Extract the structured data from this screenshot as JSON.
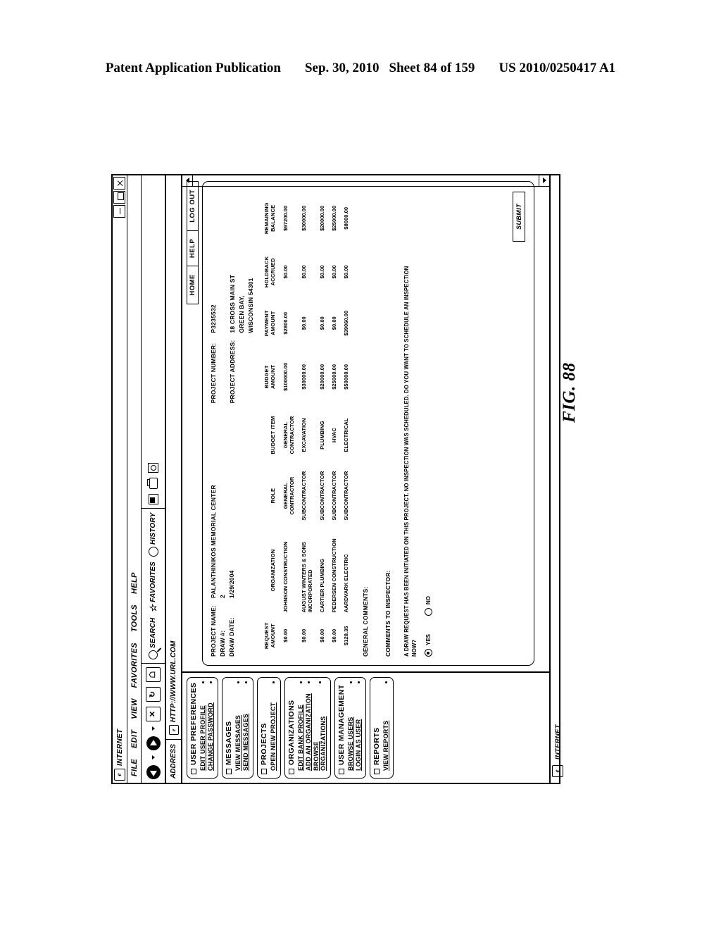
{
  "patent_header": {
    "publication": "Patent Application Publication",
    "date": "Sep. 30, 2010",
    "sheet": "Sheet 84 of 159",
    "number": "US 2010/0250417 A1"
  },
  "figure_label": "FIG. 88",
  "browser": {
    "title": "INTERNET",
    "status": "INTERNET",
    "window_buttons": [
      "minimize",
      "maximize",
      "close"
    ],
    "menu": [
      "FILE",
      "EDIT",
      "VIEW",
      "FAVORITES",
      "TOOLS",
      "HELP"
    ],
    "toolbar": {
      "back": "back-arrow",
      "forward": "forward-arrow",
      "stop": "X",
      "refresh": "refresh-icon",
      "home": "home-icon",
      "search": "SEARCH",
      "favorites": "FAVORITES",
      "history": "HISTORY",
      "mail": "mail-icon",
      "print": "print-icon",
      "edit": "edit-icon"
    },
    "address": {
      "label": "ADDRESS",
      "value": "HTTP://WWW.URL.COM"
    }
  },
  "sidebar": {
    "groups": [
      {
        "title": "USER PREFERENCES",
        "links": [
          "EDIT USER PROFILE",
          "CHANGE PASSWORD"
        ]
      },
      {
        "title": "MESSAGES",
        "links": [
          "VIEW MESSAGES",
          "SEND MESSAGES"
        ]
      },
      {
        "title": "PROJECTS",
        "links": [
          "OPEN NEW PROJECT"
        ]
      },
      {
        "title": "ORGANIZATIONS",
        "links": [
          "EDIT BANK PROFILE",
          "ADD AN ORGANIZATION",
          "BROWSE ORGANIZATIONS"
        ]
      },
      {
        "title": "USER MANAGEMENT",
        "links": [
          "BROWSE USERS",
          "LOGIN AS USER"
        ]
      },
      {
        "title": "REPORTS",
        "links": [
          "VIEW REPORTS"
        ]
      }
    ]
  },
  "topnav": [
    "HOME",
    "HELP",
    "LOG OUT"
  ],
  "project": {
    "left": [
      {
        "label": "PROJECT NAME:",
        "value": "PALANTHINIKOS MEMORIAL CENTER"
      },
      {
        "label": "DRAW #:",
        "value": "2"
      },
      {
        "label": "DRAW DATE:",
        "value": "1/29/2004"
      }
    ],
    "right": [
      {
        "label": "PROJECT NUMBER:",
        "value": "P3235532"
      },
      {
        "label": "PROJECT ADDRESS:",
        "value": "18 CROSS MAIN ST\nGREEN BAY,\nWISCONSIN 54301"
      }
    ]
  },
  "table": {
    "headers": [
      "REQUEST\nAMOUNT",
      "ORGANIZATION",
      "ROLE",
      "BUDGET ITEM",
      "BUDGET\nAMOUNT",
      "PAYMENT\nAMOUNT",
      "HOLDBACK\nACCRUED",
      "REMAINING\nBALANCE"
    ],
    "rows": [
      {
        "request": "$0.00",
        "organization": "JOHNSON CONSTRUCTION",
        "role": "GENERAL\nCONTRACTOR",
        "budget_item": "GENERAL\nCONTRACTOR",
        "budget_amount": "$100000.00",
        "payment_amount": "$2800.00",
        "holdback": "$0.00",
        "remaining": "$97200.00"
      },
      {
        "request": "$0.00",
        "organization": "AUGUST WINTERS & SONS\nINCORPORATED",
        "role": "SUBCONTRACTOR",
        "budget_item": "EXCAVATION",
        "budget_amount": "$30000.00",
        "payment_amount": "$0.00",
        "holdback": "$0.00",
        "remaining": "$30000.00"
      },
      {
        "request": "$0.00",
        "organization": "CARTIER PLUMBING",
        "role": "SUBCONTRACTOR",
        "budget_item": "PLUMBING",
        "budget_amount": "$20000.00",
        "payment_amount": "$0.00",
        "holdback": "$0.00",
        "remaining": "$20000.00"
      },
      {
        "request": "$0.00",
        "organization": "PEDERSEN CONSTRUCTION",
        "role": "SUBCONTRACTOR",
        "budget_item": "HVAC",
        "budget_amount": "$25000.00",
        "payment_amount": "$0.00",
        "holdback": "$0.00",
        "remaining": "$25000.00"
      },
      {
        "request": "$128.35",
        "organization": "AARDVARK ELECTRIC",
        "role": "SUBCONTRACTOR",
        "budget_item": "ELECTRICAL",
        "budget_amount": "$50000.00",
        "payment_amount": "$39060.00",
        "holdback": "$0.00",
        "remaining": "$8000.00"
      }
    ]
  },
  "form": {
    "general_comments_label": "GENERAL COMMENTS:",
    "comments_to_inspector_label": "COMMENTS TO INSPECTOR:",
    "draw_question": "A DRAW REQUEST HAS BEEN INITIATED ON THIS PROJECT.  NO INSPECTION WAS SCHEDULED.  DO YOU WANT TO SCHEDULE AN INSPECTION NOW?",
    "radio_yes": "YES",
    "radio_no": "NO",
    "radio_selected": "YES",
    "submit_label": "SUBMIT"
  }
}
